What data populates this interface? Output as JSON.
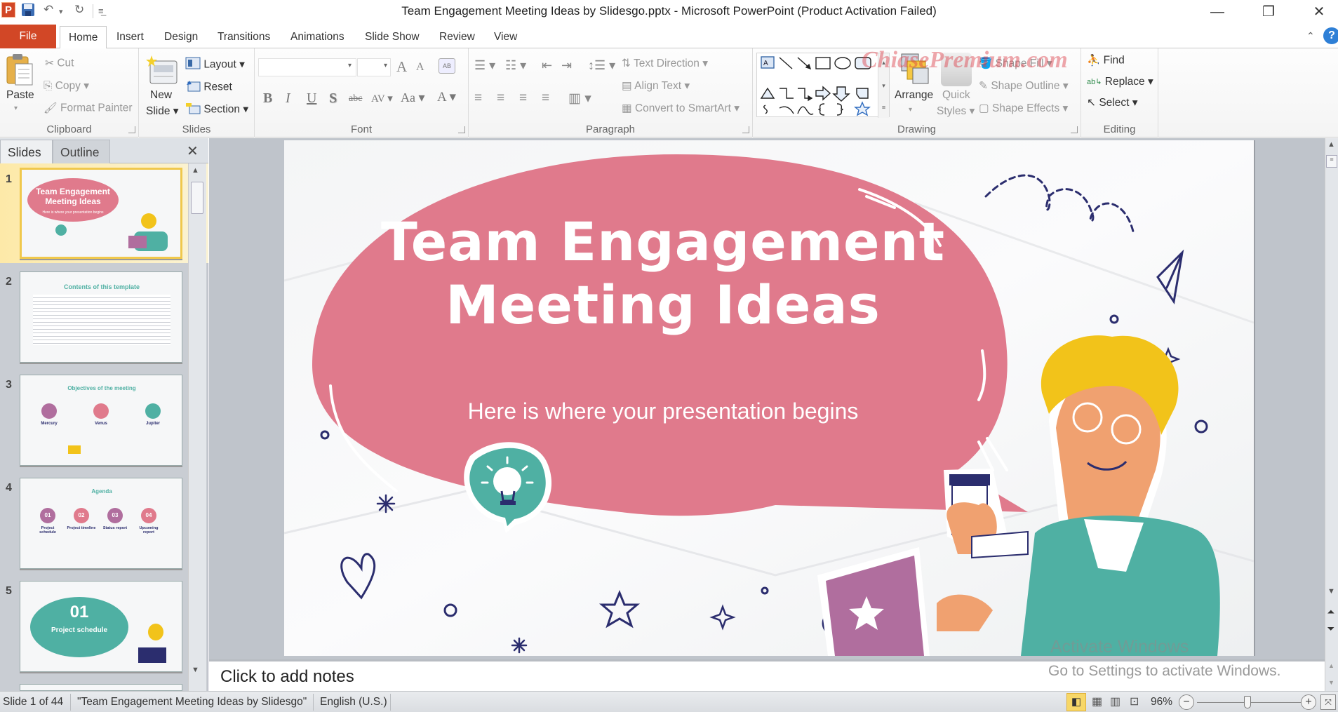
{
  "window": {
    "title": "Team Engagement Meeting Ideas by Slidesgo.pptx - Microsoft PowerPoint (Product Activation Failed)",
    "app_icon": "P",
    "controls": {
      "minimize": "—",
      "restore": "❐",
      "close": "✕"
    }
  },
  "quick_access": {
    "save": "save-icon",
    "undo": "undo-icon",
    "redo": "redo-icon",
    "customize": "customize-icon"
  },
  "tabs": [
    {
      "label": "File"
    },
    {
      "label": "Home"
    },
    {
      "label": "Insert"
    },
    {
      "label": "Design"
    },
    {
      "label": "Transitions"
    },
    {
      "label": "Animations"
    },
    {
      "label": "Slide Show"
    },
    {
      "label": "Review"
    },
    {
      "label": "View"
    }
  ],
  "ribbon": {
    "clipboard": {
      "label": "Clipboard",
      "paste": "Paste",
      "cut": "Cut",
      "copy": "Copy",
      "format_painter": "Format Painter"
    },
    "slides": {
      "label": "Slides",
      "new_slide_1": "New",
      "new_slide_2": "Slide",
      "layout": "Layout",
      "reset": "Reset",
      "section": "Section"
    },
    "font": {
      "label": "Font",
      "font_name": "",
      "font_size": "",
      "bold": "B",
      "italic": "I",
      "underline": "U",
      "shadow": "S",
      "strike": "abc",
      "spacing": "AV",
      "case": "Aa",
      "color": "A",
      "grow": "A",
      "shrink": "A"
    },
    "paragraph": {
      "label": "Paragraph",
      "text_direction": "Text Direction",
      "align_text": "Align Text",
      "smartart": "Convert to SmartArt"
    },
    "drawing": {
      "label": "Drawing",
      "arrange": "Arrange",
      "quick_styles_1": "Quick",
      "quick_styles_2": "Styles",
      "shape_fill": "Shape Fill",
      "shape_outline": "Shape Outline",
      "shape_effects": "Shape Effects"
    },
    "editing": {
      "label": "Editing",
      "find": "Find",
      "replace": "Replace",
      "select": "Select"
    },
    "watermark": "ChiasePremium.com"
  },
  "left_pane": {
    "tabs": [
      {
        "label": "Slides"
      },
      {
        "label": "Outline"
      }
    ],
    "close": "✕",
    "thumbnails": [
      {
        "number": "1",
        "title": "Team Engagement Meeting Ideas",
        "subtitle": "Here is where your presentation begins"
      },
      {
        "number": "2",
        "title": "Contents of this template"
      },
      {
        "number": "3",
        "title": "Objectives of the meeting",
        "items": [
          "Mercury",
          "Venus",
          "Jupiter"
        ]
      },
      {
        "number": "4",
        "title": "Agenda",
        "items": [
          {
            "num": "01",
            "label": "Project schedule"
          },
          {
            "num": "02",
            "label": "Project timeline"
          },
          {
            "num": "03",
            "label": "Status report"
          },
          {
            "num": "04",
            "label": "Upcoming report"
          }
        ]
      },
      {
        "number": "5",
        "title": "01",
        "subtitle": "Project schedule"
      }
    ]
  },
  "slide": {
    "title_line1": "Team Engagement",
    "title_line2": "Meeting Ideas",
    "subtitle": "Here is where your presentation begins",
    "colors": {
      "bubble": "#e07a8c",
      "teal": "#4fb0a3",
      "navy": "#2b2d6e",
      "purple": "#b06e9e",
      "hair": "#f2c31a",
      "skin": "#f0a170"
    }
  },
  "notes": {
    "placeholder": "Click to add notes"
  },
  "activation": {
    "line1": "Activate Windows",
    "line2": "Go to Settings to activate Windows."
  },
  "status_bar": {
    "slide_info": "Slide 1 of 44",
    "theme": "\"Team Engagement Meeting Ideas by Slidesgo\"",
    "language": "English (U.S.)",
    "zoom": "96%",
    "zoom_value_percent": 96
  }
}
